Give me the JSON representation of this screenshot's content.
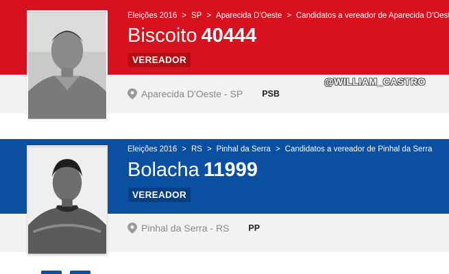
{
  "candidates": [
    {
      "breadcrumb": [
        "Eleições 2016",
        "SP",
        "Aparecida D'Oeste",
        "Candidatos a vereador de Aparecida D'Oeste"
      ],
      "name": "Biscoito",
      "number": "40444",
      "role": "VEREADOR",
      "location": "Aparecida D'Oeste - SP",
      "party": "PSB",
      "band_color": "#d7111d"
    },
    {
      "breadcrumb": [
        "Eleições 2016",
        "RS",
        "Pinhal da Serra",
        "Candidatos a vereador de Pinhal da Serra"
      ],
      "name": "Bolacha",
      "number": "11999",
      "role": "VEREADOR",
      "location": "Pinhal da Serra - RS",
      "party": "PP",
      "band_color": "#0a4fa0"
    }
  ],
  "watermark": "@WILLIAM_CASTRO",
  "icons": {
    "location": "map-pin-icon",
    "separator": "chevron-right-icon"
  }
}
